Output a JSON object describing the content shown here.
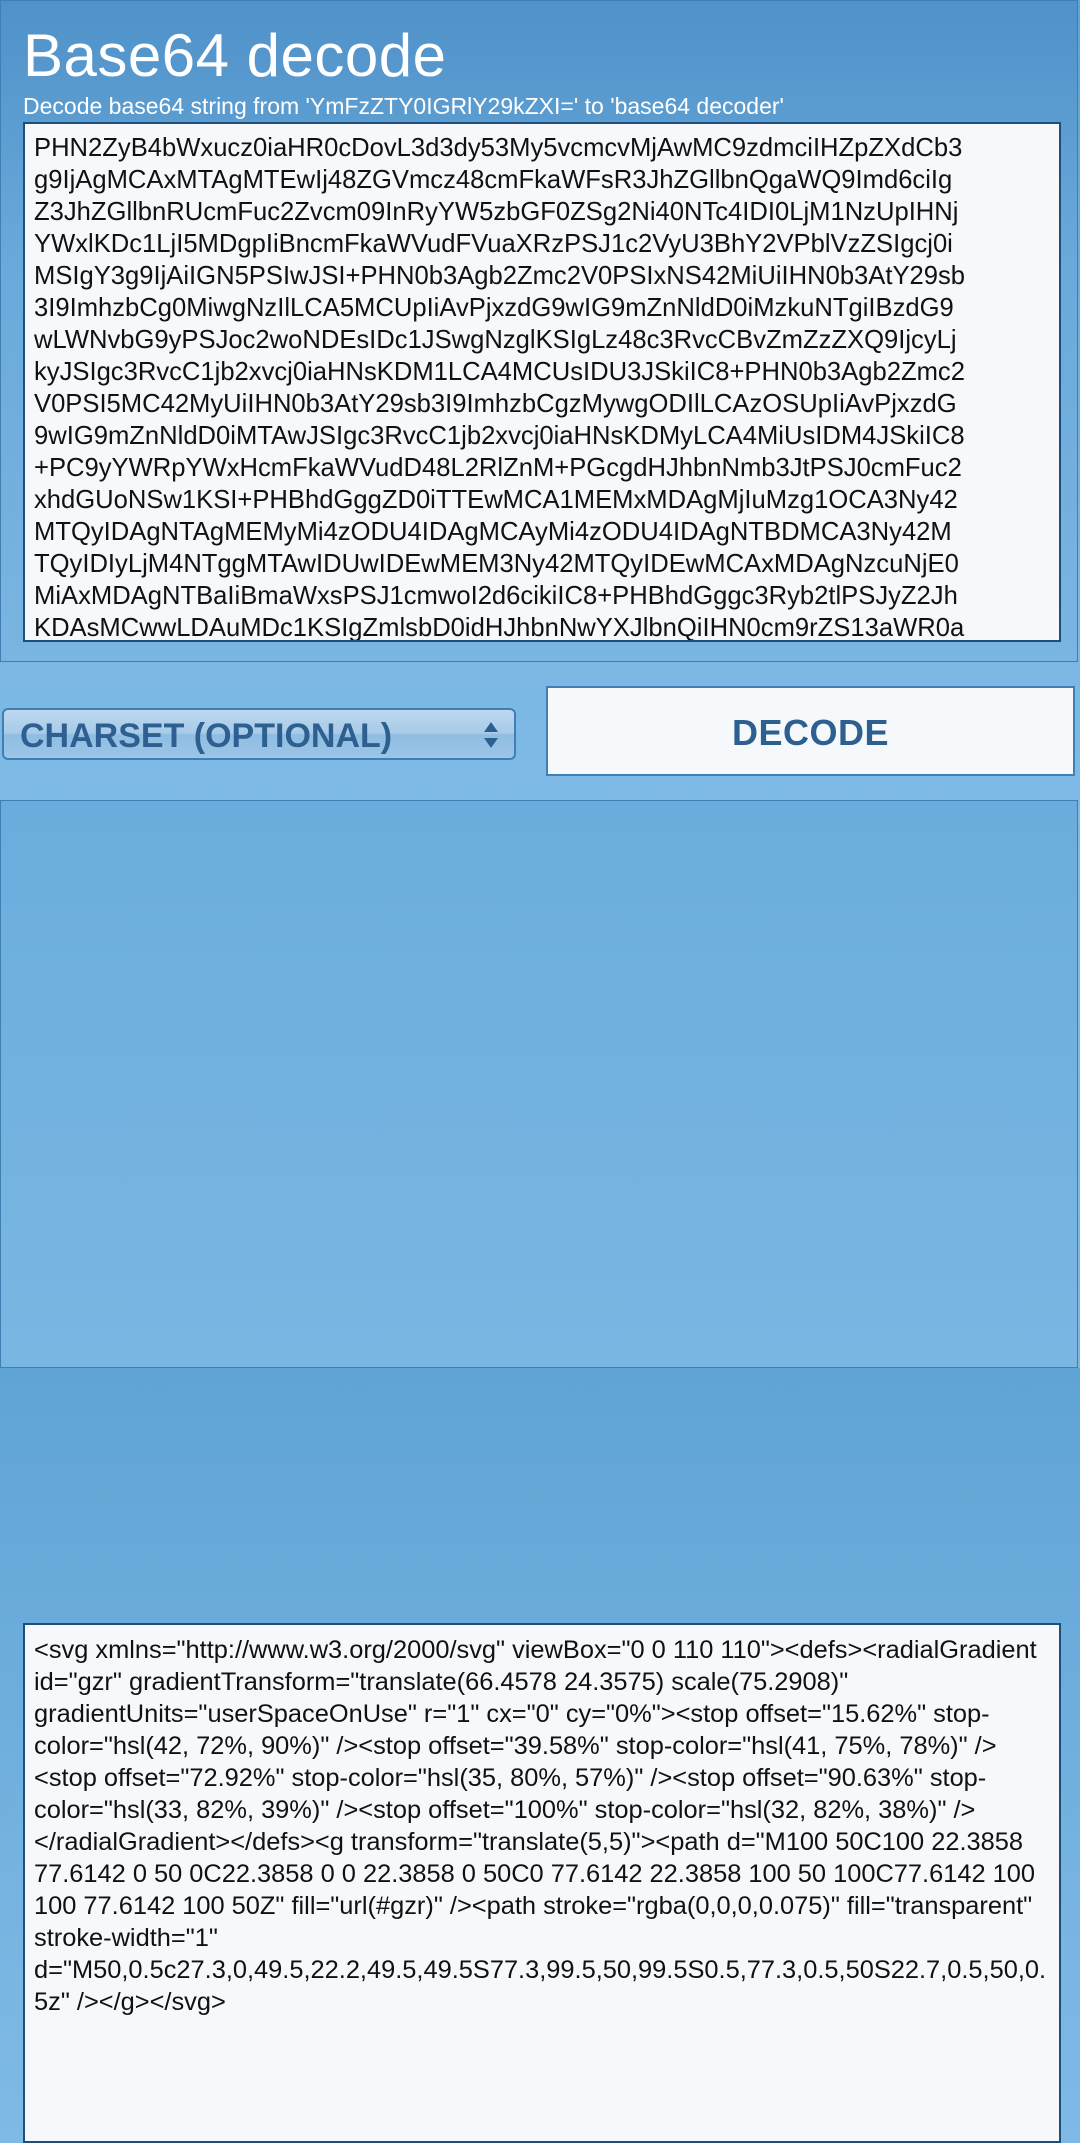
{
  "header": {
    "title": "Base64 decode",
    "subtitle": "Decode base64 string from 'YmFzZTY0IGRlY29kZXI=' to 'base64 decoder'"
  },
  "input": {
    "lines": [
      "PHN2ZyB4bWxucz0iaHR0cDovL3d3dy53My5vcmcvMjAwMC9zdmciIHZpZXdCb3",
      "g9IjAgMCAxMTAgMTEwIj48ZGVmcz48cmFkaWFsR3JhZGllbnQgaWQ9Imd6ciIg",
      "Z3JhZGllbnRUcmFuc2Zvcm09InRyYW5zbGF0ZSg2Ni40NTc4IDI0LjM1NzUpIHNj",
      "YWxlKDc1LjI5MDgpIiBncmFkaWVudFVuaXRzPSJ1c2VyU3BhY2VPblVzZSIgcj0i",
      "MSIgY3g9IjAiIGN5PSIwJSI+PHN0b3Agb2Zmc2V0PSIxNS42MiUiIHN0b3AtY29sb",
      "3I9ImhzbCg0MiwgNzIlLCA5MCUpIiAvPjxzdG9wIG9mZnNldD0iMzkuNTgiIBzdG9",
      "wLWNvbG9yPSJoc2woNDEsIDc1JSwgNzglKSIgLz48c3RvcCBvZmZzZXQ9IjcyLj",
      "kyJSIgc3RvcC1jb2xvcj0iaHNsKDM1LCA4MCUsIDU3JSkiIC8+PHN0b3Agb2Zmc2",
      "V0PSI5MC42MyUiIHN0b3AtY29sb3I9ImhzbCgzMywgODIlLCAzOSUpIiAvPjxzdG",
      "9wIG9mZnNldD0iMTAwJSIgc3RvcC1jb2xvcj0iaHNsKDMyLCA4MiUsIDM4JSkiIC8",
      "+PC9yYWRpYWxHcmFkaWVudD48L2RlZnM+PGcgdHJhbnNmb3JtPSJ0cmFuc2",
      "xhdGUoNSw1KSI+PHBhdGggZD0iTTEwMCA1MEMxMDAgMjIuMzg1OCA3Ny42",
      "MTQyIDAgNTAgMEMyMi4zODU4IDAgMCAyMi4zODU4IDAgNTBDMCA3Ny42M",
      "TQyIDIyLjM4NTggMTAwIDUwIDEwMEM3Ny42MTQyIDEwMCAxMDAgNzcuNjE0",
      "MiAxMDAgNTBaIiBmaWxsPSJ1cmwoI2d6cikiIC8+PHBhdGggc3Ryb2tlPSJyZ2Jh",
      "KDAsMCwwLDAuMDc1KSIgZmlsbD0idHJhbnNwYXJlbnQiIHN0cm9rZS13aWR0a"
    ]
  },
  "controls": {
    "charset_label": "CHARSET (OPTIONAL)",
    "decode_label": "DECODE",
    "select_icon": "chevrons-up-down-icon"
  },
  "output": {
    "text": "<svg xmlns=\"http://www.w3.org/2000/svg\" viewBox=\"0 0 110 110\"><defs><radialGradient id=\"gzr\" gradientTransform=\"translate(66.4578 24.3575) scale(75.2908)\" gradientUnits=\"userSpaceOnUse\" r=\"1\" cx=\"0\" cy=\"0%\"><stop offset=\"15.62%\" stop-color=\"hsl(42, 72%, 90%)\" /><stop offset=\"39.58%\" stop-color=\"hsl(41, 75%, 78%)\" /><stop offset=\"72.92%\" stop-color=\"hsl(35, 80%, 57%)\" /><stop offset=\"90.63%\" stop-color=\"hsl(33, 82%, 39%)\" /><stop offset=\"100%\" stop-color=\"hsl(32, 82%, 38%)\" /></radialGradient></defs><g transform=\"translate(5,5)\"><path d=\"M100 50C100 22.3858 77.6142 0 50 0C22.3858 0 0 22.3858 0 50C0 77.6142 22.3858 100 50 100C77.6142 100 100 77.6142 100 50Z\" fill=\"url(#gzr)\" /><path stroke=\"rgba(0,0,0,0.075)\" fill=\"transparent\" stroke-width=\"1\" d=\"M50,0.5c27.3,0,49.5,22.2,49.5,49.5S77.3,99.5,50,99.5S0.5,77.3,0.5,50S22.7,0.5,50,0.5z\" /></g></svg>"
  },
  "colors": {
    "background": "#6aa9da",
    "panel_border": "#3f7fb3",
    "button_text": "#2d5f91",
    "textbox_border": "#1e4f7a"
  }
}
